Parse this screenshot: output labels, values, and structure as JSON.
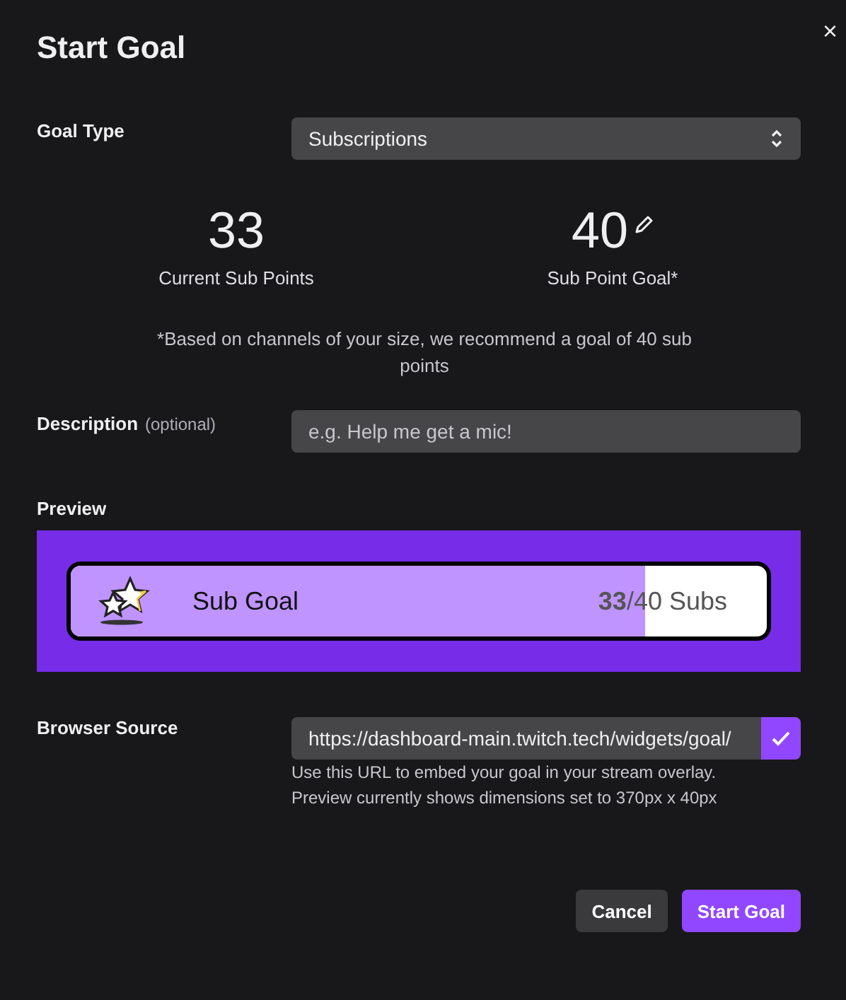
{
  "window": {
    "title": "Start Goal",
    "close": "×"
  },
  "goal_type": {
    "label": "Goal Type",
    "value": "Subscriptions"
  },
  "stats": [
    {
      "value": "33",
      "label": "Current Sub Points",
      "editable": false
    },
    {
      "value": "40",
      "label": "Sub Point Goal*",
      "editable": true
    }
  ],
  "recommendation": "*Based on channels of your size, we recommend a goal of 40 sub points",
  "description": {
    "label": "Description",
    "hint": "(optional)",
    "placeholder": "e.g. Help me get a mic!"
  },
  "preview": {
    "label": "Preview",
    "title": "Sub Goal",
    "count": "**33**/40 Subs",
    "level": 0.825
  },
  "browser_source": {
    "label": "Browser Source",
    "value": "https://dashboard-main.twitch.tech/widgets/goal/",
    "help": [
      "Use this URL to embed your goal in your stream overlay.",
      "Preview currently shows dimensions set to 370px x 40px"
    ]
  },
  "buttons": [
    {
      "label": "Cancel",
      "kind": "secondary"
    },
    {
      "label": "Start Goal",
      "kind": "primary"
    }
  ]
}
